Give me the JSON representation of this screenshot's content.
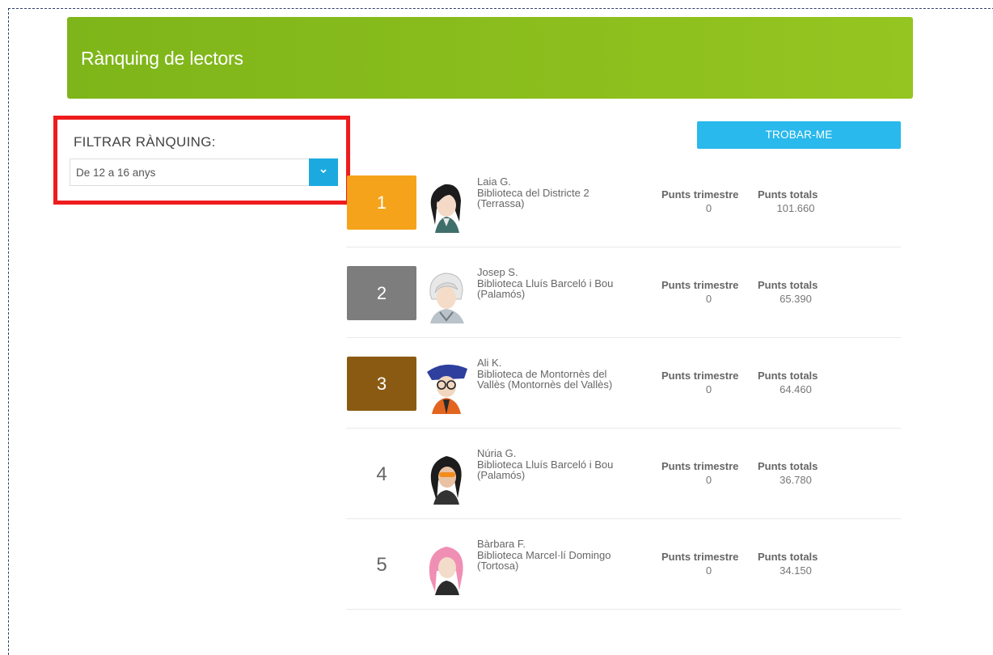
{
  "header": {
    "title": "Rànquing de lectors"
  },
  "filter": {
    "label": "FILTRAR RÀNQUING:",
    "selected": "De 12 a 16 anys"
  },
  "find_button": "TROBAR-ME",
  "columns": {
    "trimestre": "Punts trimestre",
    "totals": "Punts totals"
  },
  "colors": {
    "gold": "#f5a31a",
    "silver": "#7d7d7d",
    "bronze": "#8b5a12",
    "accent": "#1ba9e0",
    "header_green": "#8bbf1e"
  },
  "ranking": [
    {
      "rank": "1",
      "name": "Laia G.",
      "library_line1": "Biblioteca del Districte 2",
      "library_line2": "(Terrassa)",
      "punts_trimestre": "0",
      "punts_totals": "101.660",
      "avatar": "girl-black-hair-avatar"
    },
    {
      "rank": "2",
      "name": "Josep S.",
      "library_line1": "Biblioteca Lluís Barceló i Bou",
      "library_line2": "(Palamós)",
      "punts_trimestre": "0",
      "punts_totals": "65.390",
      "avatar": "boy-white-hair-avatar"
    },
    {
      "rank": "3",
      "name": "Ali K.",
      "library_line1": "Biblioteca de Montornès del",
      "library_line2": "Vallès (Montornès del Vallès)",
      "punts_trimestre": "0",
      "punts_totals": "64.460",
      "avatar": "boy-blue-hair-glasses-avatar"
    },
    {
      "rank": "4",
      "name": "Núria G.",
      "library_line1": "Biblioteca Lluís Barceló i Bou",
      "library_line2": "(Palamós)",
      "punts_trimestre": "0",
      "punts_totals": "36.780",
      "avatar": "girl-sunglasses-avatar"
    },
    {
      "rank": "5",
      "name": "Bàrbara F.",
      "library_line1": "Biblioteca Marcel·lí Domingo",
      "library_line2": "(Tortosa)",
      "punts_trimestre": "0",
      "punts_totals": "34.150",
      "avatar": "girl-pink-hair-avatar"
    }
  ]
}
